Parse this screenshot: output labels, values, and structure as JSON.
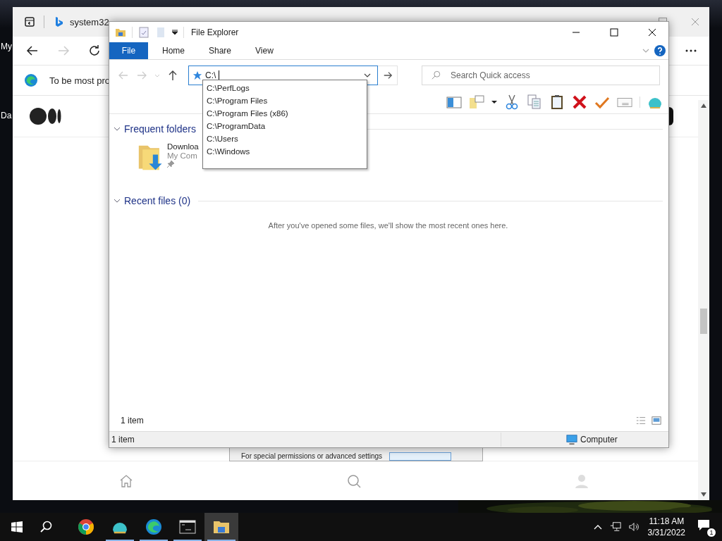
{
  "desktop": {
    "icon_labels": [
      "My",
      "Da"
    ]
  },
  "browser": {
    "tab_title": "system32",
    "infobar_text": "To be most pro"
  },
  "background_dialog": {
    "text": "For special permissions or advanced settings"
  },
  "explorer": {
    "title": "File Explorer",
    "ribbon_tabs": [
      {
        "label": "File",
        "selected": true
      },
      {
        "label": "Home",
        "selected": false
      },
      {
        "label": "Share",
        "selected": false
      },
      {
        "label": "View",
        "selected": false
      }
    ],
    "address": {
      "value": "C:\\"
    },
    "suggestions": [
      "C:\\PerfLogs",
      "C:\\Program Files",
      "C:\\Program Files (x86)",
      "C:\\ProgramData",
      "C:\\Users",
      "C:\\Windows"
    ],
    "search": {
      "placeholder": "Search Quick access"
    },
    "sections": [
      {
        "title": "Frequent folders",
        "expanded": true,
        "items": [
          {
            "name": "Downloa",
            "location": "My Com",
            "pinned": true
          }
        ]
      },
      {
        "title": "Recent files (0)",
        "expanded": true,
        "empty_message": "After you've opened some files, we'll show the most recent ones here."
      }
    ],
    "item_count": "1 item",
    "status_bar": {
      "count": "1 item",
      "location": "Computer"
    }
  },
  "taskbar": {
    "apps": [
      {
        "kind": "chrome",
        "running": false,
        "selected": false
      },
      {
        "kind": "shell",
        "running": true,
        "selected": false
      },
      {
        "kind": "edge",
        "running": true,
        "selected": false
      },
      {
        "kind": "terminal",
        "running": true,
        "selected": false
      },
      {
        "kind": "explorer",
        "running": true,
        "selected": true
      }
    ],
    "time": "11:18 AM",
    "date": "3/31/2022",
    "notification_count": "1"
  }
}
